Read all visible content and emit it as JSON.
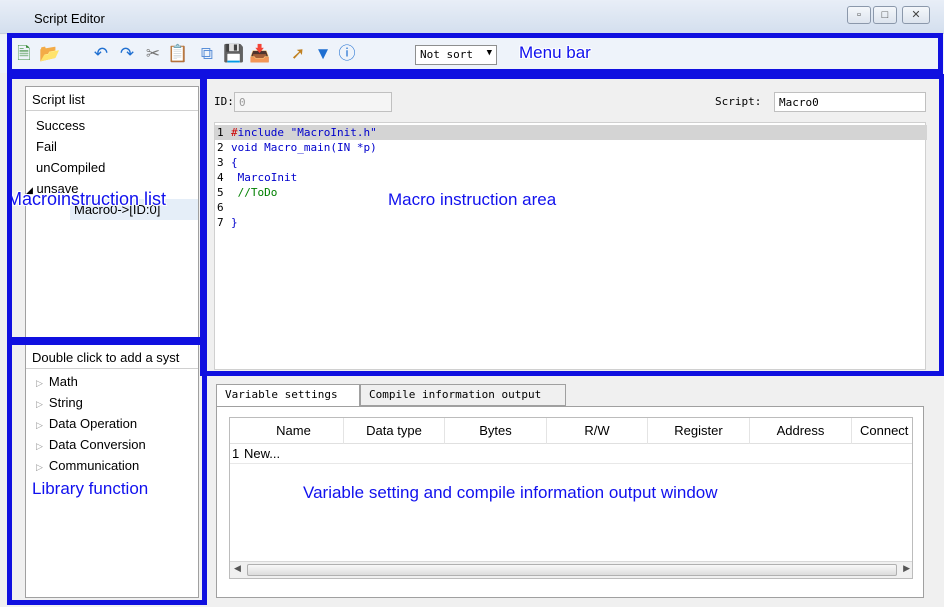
{
  "window": {
    "title": "Script Editor"
  },
  "toolbar": {
    "icons": [
      "new-file-icon",
      "open-folder-icon",
      "undo-icon",
      "redo-icon",
      "cut-icon",
      "paste-icon",
      "copy-icon",
      "save-icon",
      "save-as-icon",
      "compile-wand-icon",
      "filter-icon",
      "help-icon"
    ],
    "sort_value": "Not sort"
  },
  "annotations": {
    "menu_bar": "Menu bar",
    "macro_list": "Macroinstruction list",
    "macro_area": "Macro instruction area",
    "library": "Library function",
    "variable_window": "Variable setting and compile information output window"
  },
  "script_list": {
    "header": "Script list",
    "items": [
      "Success",
      "Fail",
      "unCompiled",
      "unsave"
    ],
    "child": "Macro0->[ID:0]"
  },
  "editor": {
    "id_label": "ID:",
    "id_value": "0",
    "script_label": "Script:",
    "script_value": "Macro0",
    "line_numbers": [
      "1",
      "2",
      "3",
      "4",
      "5",
      "6",
      "7"
    ],
    "lines": [
      {
        "pre": "#",
        "text": "include \"MacroInit.h\""
      },
      {
        "pre": "",
        "text": "void Macro_main(IN *p)"
      },
      {
        "pre": "",
        "text": "{"
      },
      {
        "pre": "",
        "text": " MarcoInit"
      },
      {
        "pre": "",
        "text": " //ToDo"
      },
      {
        "pre": "",
        "text": ""
      },
      {
        "pre": "",
        "text": "}"
      }
    ]
  },
  "library": {
    "header": "Double click to add a syst",
    "items": [
      "Math",
      "String",
      "Data Operation",
      "Data Conversion",
      "Communication"
    ]
  },
  "bottom_tabs": [
    "Variable settings",
    "Compile information output"
  ],
  "variable_table": {
    "columns": [
      "Name",
      "Data type",
      "Bytes",
      "R/W",
      "Register",
      "Address",
      "Connect"
    ],
    "rows": [
      {
        "index": "1",
        "name": "New..."
      }
    ]
  },
  "colors": {
    "annotation_blue": "#1010e0",
    "code_blue": "#0000cc",
    "code_green": "#008000",
    "code_red": "#cc0000"
  }
}
